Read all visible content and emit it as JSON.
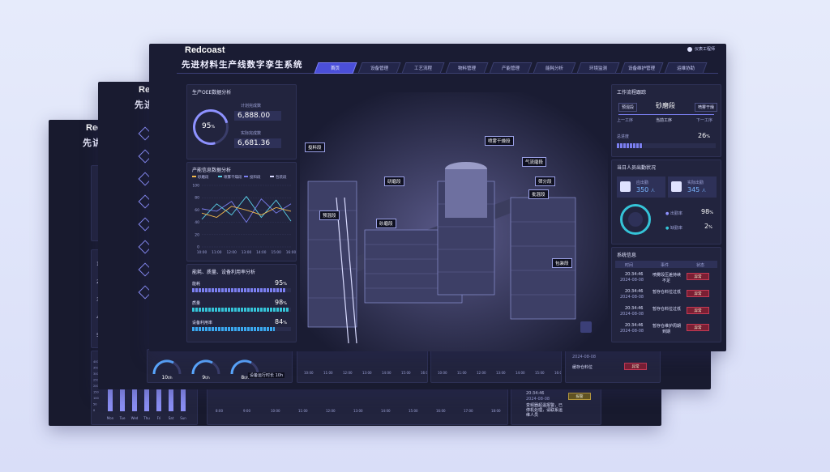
{
  "brand": "Redcoast",
  "brand_short": "Rec",
  "brand_short2": "Red",
  "system_title": "先进材料生产线数字孪生系统",
  "system_title_short1": "先进",
  "system_title_short2": "先讲",
  "user": "仪表工程师",
  "tabs": [
    "首页",
    "设备管理",
    "工艺流程",
    "物料管理",
    "产能管理",
    "能耗分析",
    "环境监测",
    "设备维护管理",
    "运维协助"
  ],
  "oee": {
    "title": "生产OEE数据分析",
    "percent": "95",
    "percent_unit": "%",
    "plan_label": "计划完成数",
    "plan_value": "6,888.00",
    "actual_label": "实际完成数",
    "actual_value": "6,681.36"
  },
  "capacity": {
    "title": "产能信息数据分析",
    "legend": [
      "砂磨段",
      "喷雾干燥段",
      "投料段",
      "包装段"
    ],
    "legend_colors": [
      "#f2b84b",
      "#5ad0e8",
      "#7b7ff0",
      "#d9d9ff"
    ],
    "y_ticks": [
      "100",
      "80",
      "60",
      "40",
      "20",
      "0"
    ],
    "x_ticks": [
      "10:00",
      "11:00",
      "12:00",
      "13:00",
      "14:00",
      "15:00",
      "16:00"
    ],
    "series": [
      {
        "color": "#7b7ff0",
        "values": [
          62,
          58,
          74,
          40,
          78,
          55,
          70
        ]
      },
      {
        "color": "#5ad0e8",
        "values": [
          45,
          70,
          52,
          82,
          48,
          76,
          42
        ]
      },
      {
        "color": "#f2b84b",
        "values": [
          55,
          48,
          66,
          60,
          52,
          64,
          58
        ]
      }
    ]
  },
  "utilization": {
    "title": "能耗、质量、设备利用率分析",
    "items": [
      {
        "label": "能耗",
        "value": "95",
        "unit": "%",
        "fraction": 0.95
      },
      {
        "label": "质量",
        "value": "98",
        "unit": "%",
        "fraction": 0.98
      },
      {
        "label": "设备利用率",
        "value": "84",
        "unit": "%",
        "fraction": 0.84
      }
    ]
  },
  "scene_tags": [
    "投料段",
    "喷雾干燥段",
    "气流磨段",
    "筛分段",
    "批混段",
    "预混段",
    "砂磨段",
    "包装段",
    "研磨段"
  ],
  "workflow": {
    "title": "工作流程跟踪",
    "prev": "预混段",
    "current": "砂磨段",
    "next": "喷雾干燥",
    "prev_label": "上一工序",
    "current_label": "当前工序",
    "next_label": "下一工序",
    "progress_label": "总进度",
    "progress_value": "26",
    "progress_unit": "%",
    "progress_fraction": 0.26
  },
  "attendance": {
    "title": "当日人员出勤状况",
    "should_label": "应出勤",
    "should_value": "350",
    "should_unit": "人",
    "actual_label": "实际出勤",
    "actual_value": "345",
    "actual_unit": "人",
    "rate_label": "出勤率",
    "rate_value": "98",
    "absent_label": "缺勤率",
    "absent_value": "2",
    "unit": "%"
  },
  "sysinfo": {
    "title": "系统信息",
    "headers": [
      "时间",
      "事件",
      "状态"
    ],
    "rows": [
      {
        "time": "20:34:46",
        "date": "2024-08-08",
        "event": "喷雾段压差持续",
        "event2": "不足",
        "status": "异常"
      },
      {
        "time": "20:34:46",
        "date": "2024-08-08",
        "event": "暂存仓料位过低",
        "event2": "",
        "status": "异常"
      },
      {
        "time": "20:34:46",
        "date": "2024-08-08",
        "event": "暂存仓料位过低",
        "event2": "",
        "status": "异常"
      },
      {
        "time": "20:34:46",
        "date": "2024-08-08",
        "event": "暂存仓维护周期",
        "event2": "到期",
        "status": "异常"
      }
    ]
  },
  "back2": {
    "gauge_labels": [
      "10",
      "9",
      "8"
    ],
    "gauge_units": [
      "t/h",
      "t/h",
      "t/h"
    ],
    "gauge_extra": "设备运行时长",
    "gauge_extra_val": "10h",
    "x_ticks": [
      "10:00",
      "11:00",
      "12:00",
      "13:00",
      "14:00",
      "15:00",
      "16:00"
    ],
    "row_date": "2024-08-08",
    "row_event": "缓存仓料位",
    "row_status": "异常"
  },
  "back3": {
    "days": [
      "Mon",
      "Tue",
      "Wed",
      "Thu",
      "Fri",
      "Sat",
      "Sun"
    ],
    "bars": [
      0.7,
      0.8,
      0.65,
      0.9,
      0.75,
      0.85,
      0.6
    ],
    "y_ticks": [
      "400",
      "350",
      "300",
      "250",
      "200",
      "150",
      "100",
      "50",
      "0"
    ],
    "x_ticks": [
      "8:00",
      "9:00",
      "10:00",
      "11:00",
      "12:00",
      "13:00",
      "14:00",
      "15:00",
      "16:00",
      "17:00",
      "18:00"
    ],
    "row_time": "20:34:46",
    "row_date": "2024-08-08",
    "row_event": "变频器超温报警，已停机处理，请联系运维人员",
    "row_status": "报警",
    "left_nums": [
      "1",
      "2",
      "3",
      "4",
      "5"
    ]
  }
}
